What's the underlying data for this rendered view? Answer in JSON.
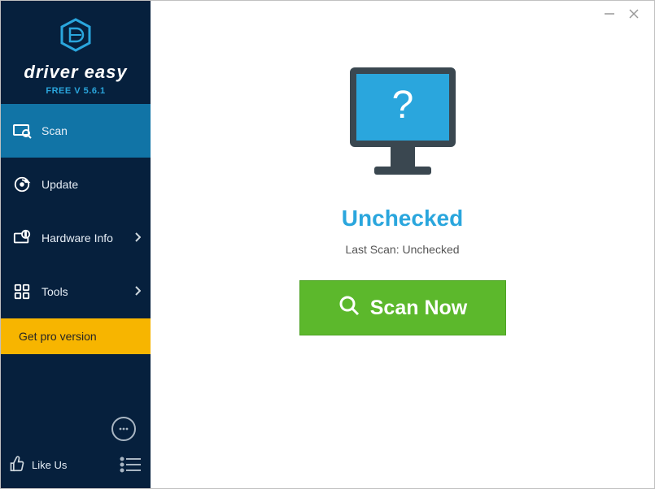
{
  "brand": {
    "name": "driver easy",
    "version": "FREE V 5.6.1"
  },
  "sidebar": {
    "items": [
      {
        "label": "Scan"
      },
      {
        "label": "Update"
      },
      {
        "label": "Hardware Info"
      },
      {
        "label": "Tools"
      }
    ],
    "pro": "Get pro version",
    "likeus": "Like Us"
  },
  "main": {
    "status_title": "Unchecked",
    "status_sub": "Last Scan: Unchecked",
    "scan_button": "Scan Now"
  }
}
